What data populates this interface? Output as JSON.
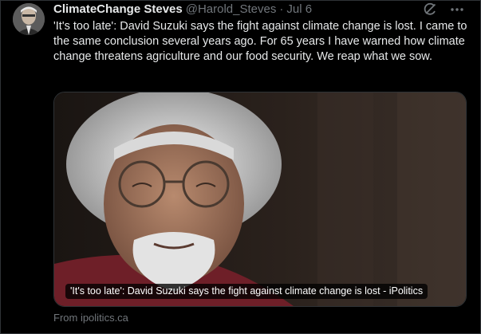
{
  "tweet": {
    "display_name": "ClimateChange Steves",
    "handle": "@Harold_Steves",
    "separator": "·",
    "date": "Jul 6",
    "text": "'It's too late': David Suzuki says the fight against climate change is lost. I came to the same conclusion several years ago. For 65 years I have warned how climate change threatens agriculture and  our food security. We reap what we sow."
  },
  "card": {
    "caption": "'It's too late': David Suzuki says the fight against climate change is lost - iPolitics",
    "source": "From ipolitics.ca"
  },
  "icons": {
    "avatar": "avatar",
    "grok": "grok-icon",
    "more": "more-icon"
  },
  "colors": {
    "background": "#000000",
    "text": "#e7e9ea",
    "muted": "#71767b",
    "border": "#2f3336"
  }
}
